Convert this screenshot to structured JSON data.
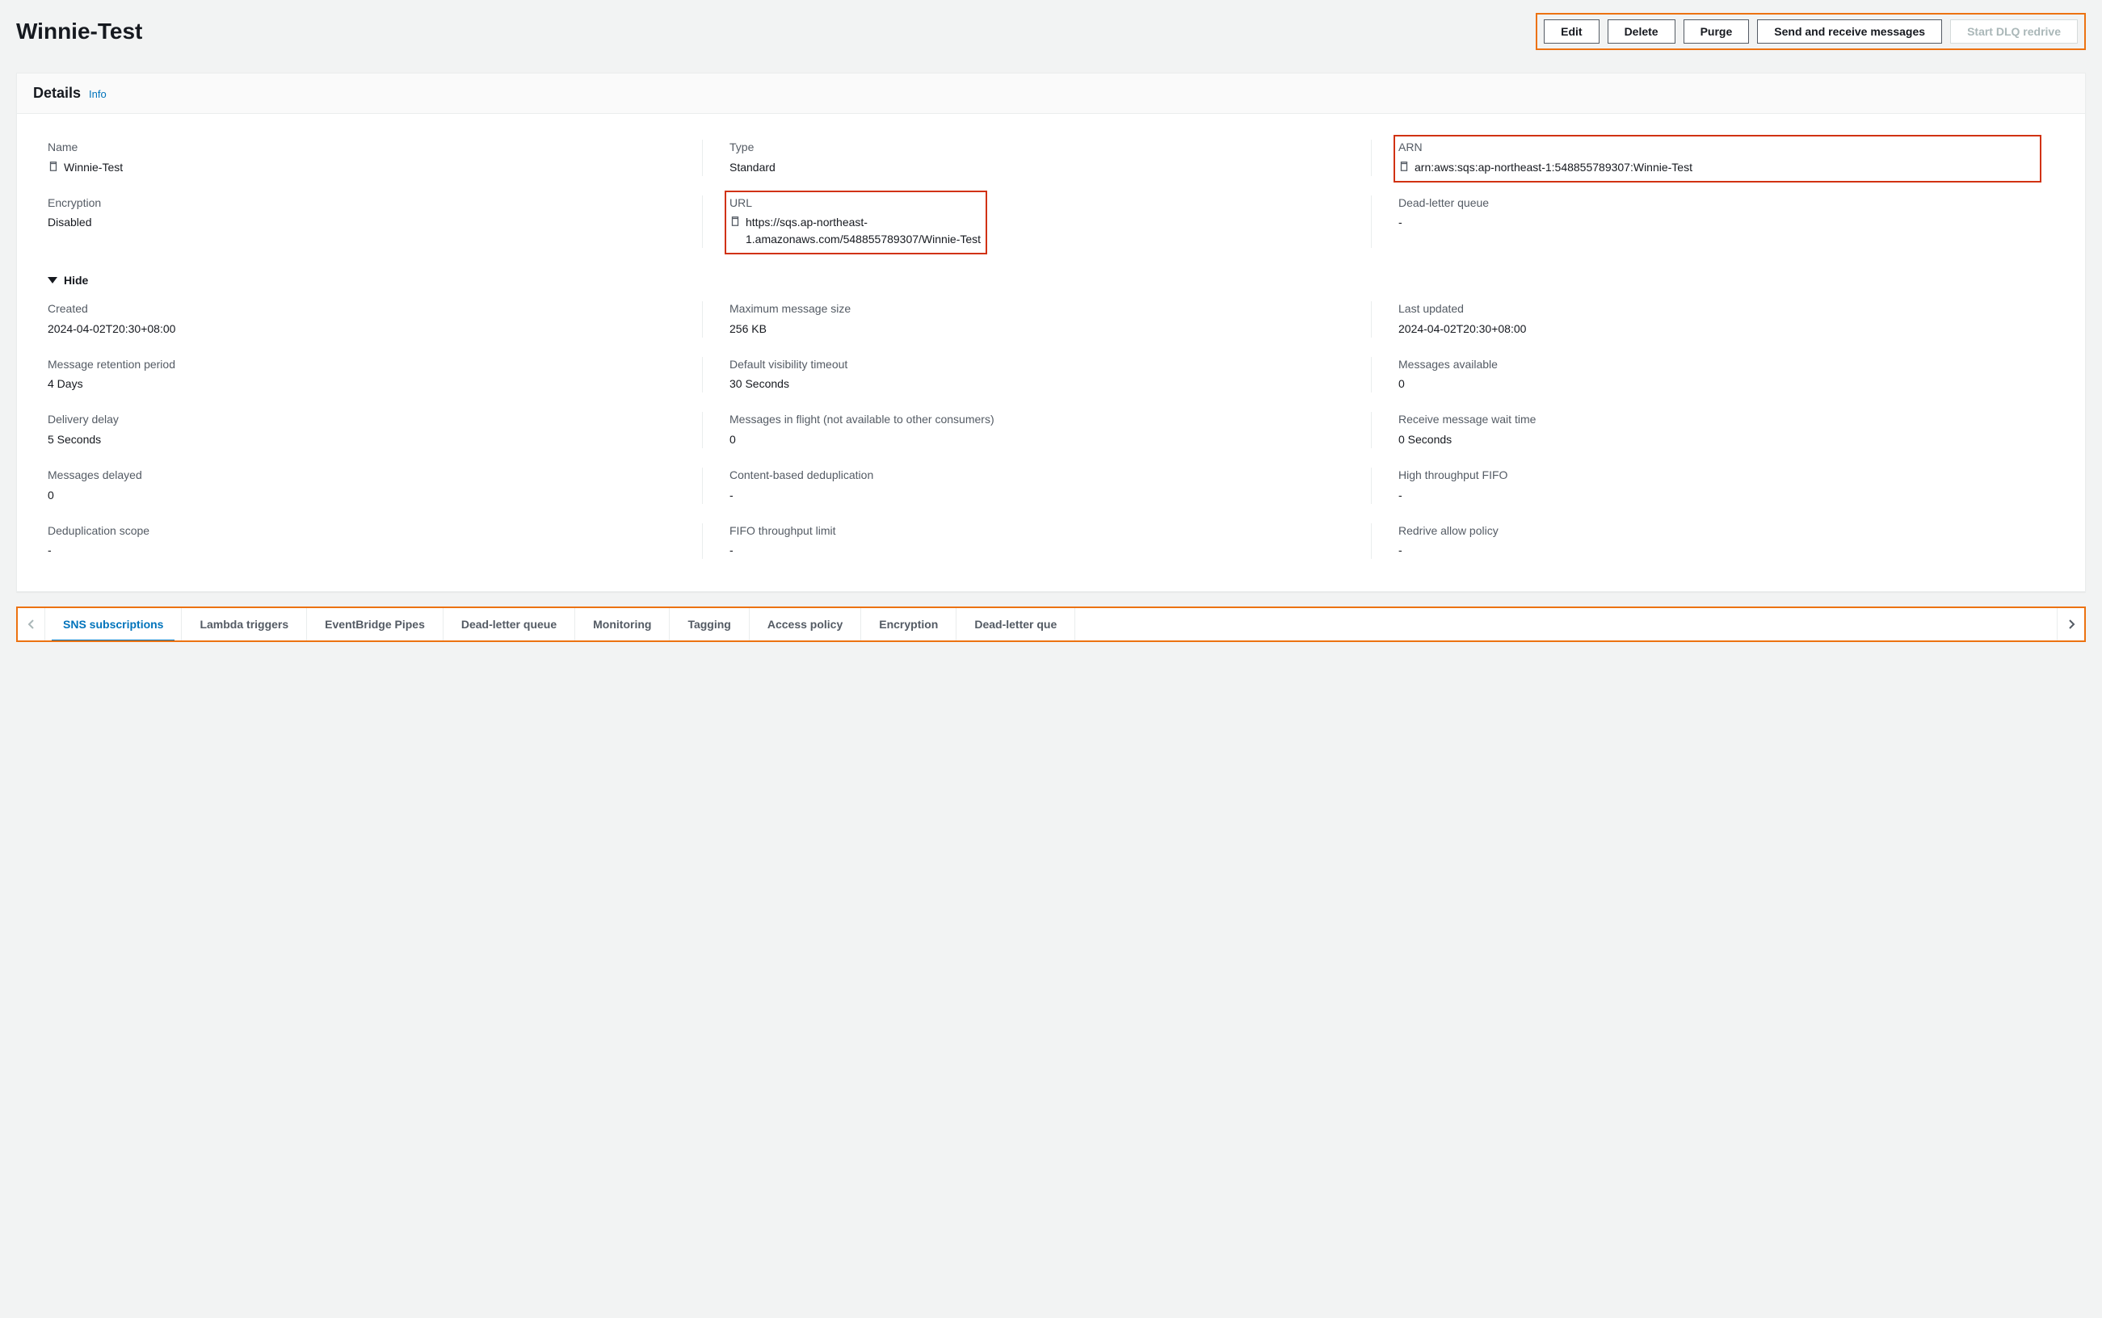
{
  "header": {
    "title": "Winnie-Test",
    "buttons": {
      "edit": "Edit",
      "delete": "Delete",
      "purge": "Purge",
      "send_receive": "Send and receive messages",
      "dlq_redrive": "Start DLQ redrive"
    }
  },
  "details": {
    "panel_title": "Details",
    "info": "Info",
    "hide_label": "Hide",
    "row1": {
      "name_label": "Name",
      "name_value": "Winnie-Test",
      "type_label": "Type",
      "type_value": "Standard",
      "arn_label": "ARN",
      "arn_value": "arn:aws:sqs:ap-northeast-1:548855789307:Winnie-Test"
    },
    "row2": {
      "enc_label": "Encryption",
      "enc_value": "Disabled",
      "url_label": "URL",
      "url_value": "https://sqs.ap-northeast-1.amazonaws.com/548855789307/Winnie-Test",
      "dlq_label": "Dead-letter queue",
      "dlq_value": "-"
    },
    "row3": {
      "created_label": "Created",
      "created_value": "2024-04-02T20:30+08:00",
      "mms_label": "Maximum message size",
      "mms_value": "256 KB",
      "updated_label": "Last updated",
      "updated_value": "2024-04-02T20:30+08:00"
    },
    "row4": {
      "mrp_label": "Message retention period",
      "mrp_value": "4 Days",
      "dvt_label": "Default visibility timeout",
      "dvt_value": "30 Seconds",
      "ma_label": "Messages available",
      "ma_value": "0"
    },
    "row5": {
      "dd_label": "Delivery delay",
      "dd_value": "5 Seconds",
      "mif_label": "Messages in flight (not available to other consumers)",
      "mif_value": "0",
      "rmwt_label": "Receive message wait time",
      "rmwt_value": "0 Seconds"
    },
    "row6": {
      "md_label": "Messages delayed",
      "md_value": "0",
      "cbd_label": "Content-based deduplication",
      "cbd_value": "-",
      "htf_label": "High throughput FIFO",
      "htf_value": "-"
    },
    "row7": {
      "ds_label": "Deduplication scope",
      "ds_value": "-",
      "ftl_label": "FIFO throughput limit",
      "ftl_value": "-",
      "rap_label": "Redrive allow policy",
      "rap_value": "-"
    }
  },
  "tabs": {
    "sns": "SNS subscriptions",
    "lambda": "Lambda triggers",
    "pipes": "EventBridge Pipes",
    "dlq": "Dead-letter queue",
    "monitoring": "Monitoring",
    "tagging": "Tagging",
    "access": "Access policy",
    "encryption": "Encryption",
    "dlq2": "Dead-letter que"
  }
}
